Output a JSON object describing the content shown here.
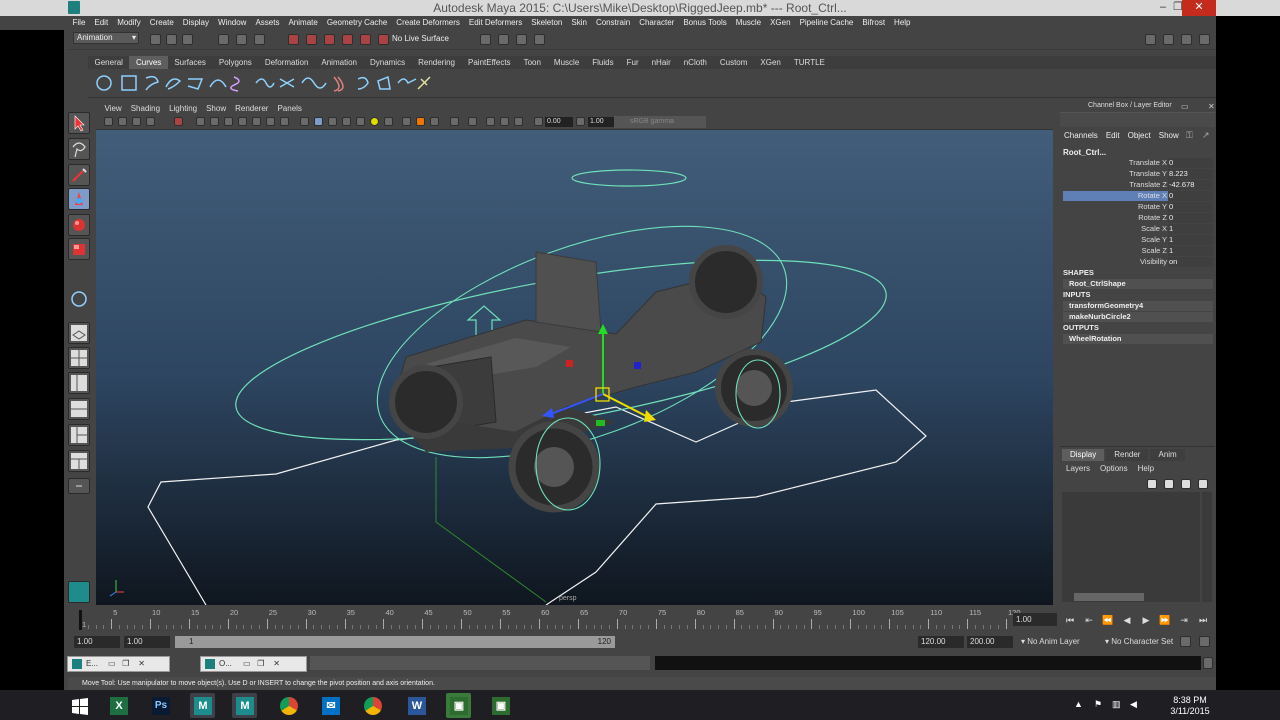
{
  "window": {
    "title": "Autodesk Maya 2015: C:\\Users\\Mike\\Desktop\\RiggedJeep.mb*   ---   Root_Ctrl..."
  },
  "menubar": [
    "File",
    "Edit",
    "Modify",
    "Create",
    "Display",
    "Window",
    "Assets",
    "Animate",
    "Geometry Cache",
    "Create Deformers",
    "Edit Deformers",
    "Skeleton",
    "Skin",
    "Constrain",
    "Character",
    "Bonus Tools",
    "Muscle",
    "XGen",
    "Pipeline Cache",
    "Bifrost",
    "Help"
  ],
  "statusline": {
    "mode": "Animation",
    "live_surface": "No Live Surface"
  },
  "shelf_tabs": [
    "General",
    "Curves",
    "Surfaces",
    "Polygons",
    "Deformation",
    "Animation",
    "Dynamics",
    "Rendering",
    "PaintEffects",
    "Toon",
    "Muscle",
    "Fluids",
    "Fur",
    "nHair",
    "nCloth",
    "Custom",
    "XGen",
    "TURTLE"
  ],
  "shelf_active": "Curves",
  "panel_menu": [
    "View",
    "Shading",
    "Lighting",
    "Show",
    "Renderer",
    "Panels"
  ],
  "panel_tools": {
    "exposure": "0.00",
    "gamma": "1.00",
    "color_space": "sRGB gamma"
  },
  "viewport": {
    "camera": "persp"
  },
  "channel_box": {
    "title": "Channel Box / Layer Editor",
    "menu": [
      "Channels",
      "Edit",
      "Object",
      "Show"
    ],
    "object": "Root_Ctrl...",
    "attributes": [
      {
        "label": "Translate X",
        "value": "0"
      },
      {
        "label": "Translate Y",
        "value": "8.223"
      },
      {
        "label": "Translate Z",
        "value": "-42.678"
      },
      {
        "label": "Rotate X",
        "value": "0",
        "selected": true
      },
      {
        "label": "Rotate Y",
        "value": "0"
      },
      {
        "label": "Rotate Z",
        "value": "0"
      },
      {
        "label": "Scale X",
        "value": "1"
      },
      {
        "label": "Scale Y",
        "value": "1"
      },
      {
        "label": "Scale Z",
        "value": "1"
      },
      {
        "label": "Visibility",
        "value": "on"
      }
    ],
    "shapes_header": "SHAPES",
    "shapes": [
      "Root_CtrlShape"
    ],
    "inputs_header": "INPUTS",
    "inputs": [
      "transformGeometry4",
      "makeNurbCircle2"
    ],
    "outputs_header": "OUTPUTS",
    "outputs": [
      "WheelRotation"
    ]
  },
  "layer_editor": {
    "tabs": [
      "Display",
      "Render",
      "Anim"
    ],
    "active": "Display",
    "menu": [
      "Layers",
      "Options",
      "Help"
    ]
  },
  "time_slider": {
    "ticks": [
      "1",
      "5",
      "10",
      "15",
      "20",
      "25",
      "30",
      "35",
      "40",
      "45",
      "50",
      "55",
      "60",
      "65",
      "70",
      "75",
      "80",
      "85",
      "90",
      "95",
      "100",
      "105",
      "110",
      "115",
      "120"
    ],
    "current": "1.00"
  },
  "range": {
    "start": "1.00",
    "playback_start": "1.00",
    "slider_start": "1",
    "slider_end": "120",
    "playback_end": "120.00",
    "end": "200.00",
    "anim_layer": "No Anim Layer",
    "char_set": "No Character Set"
  },
  "minimized": [
    {
      "label": "E..."
    },
    {
      "label": "O..."
    }
  ],
  "help_line": "Move Tool: Use manipulator to move object(s). Use D or INSERT to change the pivot position and axis orientation.",
  "taskbar": {
    "time": "8:38 PM",
    "date": "3/11/2015"
  },
  "colors": {
    "selection": "#5f80b7",
    "nurbs_curve": "#6fe0b8",
    "viewport_top": "#44607d",
    "viewport_bottom": "#0f161f"
  }
}
